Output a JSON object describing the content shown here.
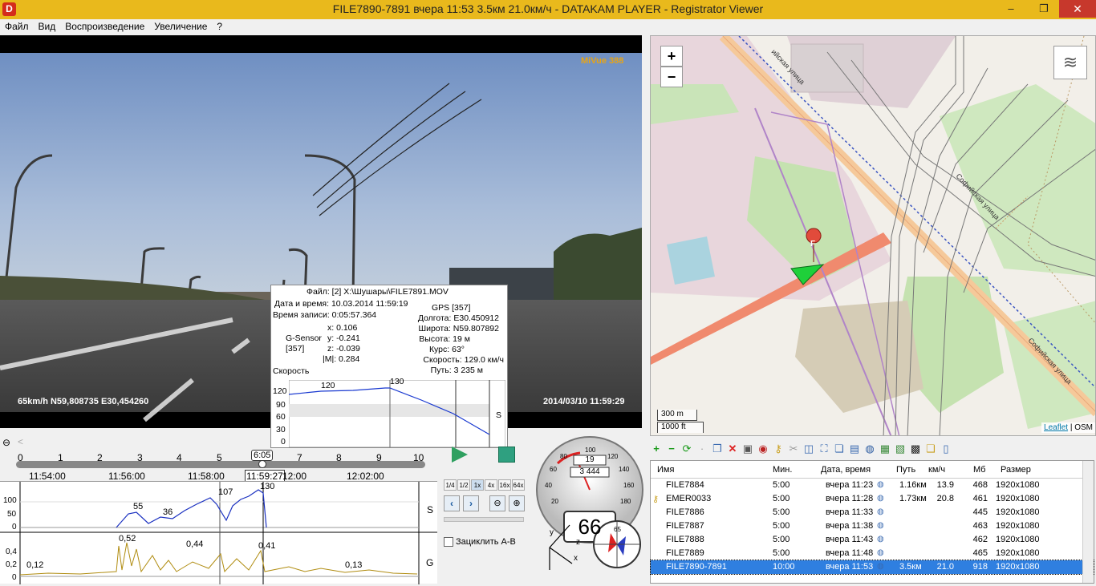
{
  "window": {
    "title": "FILE7890-7891     вчера 11:53     3.5км     21.0км/ч  -  DATAKAM PLAYER - Registrator Viewer",
    "icon_letter": "D",
    "min": "–",
    "max": "❐",
    "close": "✕"
  },
  "menu": [
    "Файл",
    "Вид",
    "Воспроизведение",
    "Увеличение",
    "?"
  ],
  "video": {
    "brand": "MiVue 388",
    "gps_text": "65km/h N59,808735 E30,454260",
    "timestamp": "2014/03/10 11:59:29"
  },
  "info": {
    "file": "Файл: [2] X:\\Шушары\\FILE7891.MOV",
    "datetime": "Дата и время: 10.03.2014 11:59:19",
    "rec_time": "Время записи: 0:05:57.364",
    "gps": "GPS [357]",
    "lon": "Долгота: E30.450912",
    "lat": "Широта: N59.807892",
    "alt": "Высота: 19 м",
    "course": "Курс: 63°",
    "speed": "Скорость: 129.0 км/ч",
    "path": "Путь: 3 235 м",
    "gsensor": "G-Sensor",
    "gcount": "[357]",
    "gx": "x: 0.106",
    "gy": "y: -0.241",
    "gz": "z: -0.039",
    "gm": "|M|: 0.284",
    "speed_label": "Скорость",
    "y_ticks": [
      "120",
      "90",
      "60",
      "30",
      "0"
    ],
    "v1": "120",
    "v2": "130",
    "s_mark": "S"
  },
  "map": {
    "zoom_in": "+",
    "zoom_out": "−",
    "scale_m": "300 m",
    "scale_ft": "1000 ft",
    "attr_leaflet": "Leaflet",
    "attr_sep": " | ",
    "attr_osm": "OSM",
    "marker": "F",
    "streets": [
      "Софийская улица",
      "Софийская улица",
      "Софийская улица",
      "Софийская",
      "ийская улица"
    ]
  },
  "timeline": {
    "ticks": [
      "0",
      "1",
      "2",
      "3",
      "4",
      "5",
      "6",
      "7",
      "8",
      "9",
      "10"
    ],
    "cursor": "6:05",
    "times": [
      "11:54:00",
      "11:56:00",
      "11:58:00",
      "11:59:27",
      "12:00",
      "12:02:00"
    ]
  },
  "graphs": {
    "s_label": "S",
    "g_label": "G",
    "s_ticks": [
      "100",
      "50",
      "0"
    ],
    "g_ticks": [
      "0,4",
      "0,2",
      "0"
    ],
    "s_vals": [
      "55",
      "36",
      "107",
      "130"
    ],
    "g_vals": [
      "0,12",
      "0,52",
      "0,44",
      "0,41",
      "0,13"
    ]
  },
  "speeds": [
    "1/4",
    "1/2",
    "1x",
    "4x",
    "16x",
    "64x"
  ],
  "loop_label": "Зациклить А-В",
  "gauge": {
    "speed": "66",
    "dist": "3 444",
    "odo": "19",
    "ticks": [
      "20",
      "40",
      "60",
      "80",
      "100",
      "120",
      "140",
      "160",
      "180",
      "200"
    ],
    "compass": "65",
    "axes": [
      "y",
      "z",
      "x"
    ]
  },
  "table": {
    "headers": [
      "Имя",
      "Мин.",
      "Дата, время",
      "Путь",
      "км/ч",
      "Мб",
      "Размер"
    ],
    "rows": [
      [
        "FILE7884",
        "5:00",
        "вчера 11:23",
        "1.16км",
        "13.9",
        "468",
        "1920x1080"
      ],
      [
        "EMER0033",
        "5:00",
        "вчера 11:28",
        "1.73км",
        "20.8",
        "461",
        "1920x1080"
      ],
      [
        "FILE7886",
        "5:00",
        "вчера 11:33",
        "",
        "",
        "445",
        "1920x1080"
      ],
      [
        "FILE7887",
        "5:00",
        "вчера 11:38",
        "",
        "",
        "463",
        "1920x1080"
      ],
      [
        "FILE7888",
        "5:00",
        "вчера 11:43",
        "",
        "",
        "462",
        "1920x1080"
      ],
      [
        "FILE7889",
        "5:00",
        "вчера 11:48",
        "",
        "",
        "465",
        "1920x1080"
      ],
      [
        "FILE7890-7891",
        "10:00",
        "вчера 11:53",
        "3.5км",
        "21.0",
        "918",
        "1920x1080"
      ]
    ]
  }
}
